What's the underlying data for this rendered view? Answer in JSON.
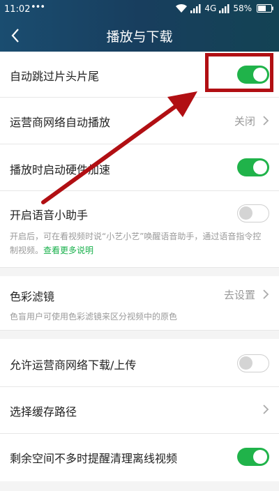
{
  "status_bar": {
    "time": "11:02",
    "dots": "•••",
    "network": "4G",
    "battery": "58%"
  },
  "header": {
    "title": "播放与下载"
  },
  "settings": [
    {
      "label": "自动跳过片头片尾",
      "control": "toggle",
      "on": true
    },
    {
      "label": "运营商网络自动播放",
      "control": "value",
      "value": "关闭"
    },
    {
      "label": "播放时启动硬件加速",
      "control": "toggle",
      "on": true
    },
    {
      "label": "开启语音小助手",
      "control": "toggle",
      "on": false,
      "description": "开启后，可在看视频时说“小艺小艺”唤醒语音助手，通过语音指令控制视频。",
      "link": "查看更多说明"
    },
    {
      "label": "色彩滤镜",
      "control": "value",
      "value": "去设置",
      "description": "色盲用户可使用色彩滤镜来区分视频中的原色"
    },
    {
      "label": "允许运营商网络下载/上传",
      "control": "toggle",
      "on": false
    },
    {
      "label": "选择缓存路径",
      "control": "chevron"
    },
    {
      "label": "剩余空间不多时提醒清理离线视频",
      "control": "toggle",
      "on": true
    }
  ],
  "colors": {
    "accent_green": "#20b34a",
    "link_green": "#18b04b",
    "annotation_red": "#b10f13",
    "header_blue": "#183e5e"
  }
}
